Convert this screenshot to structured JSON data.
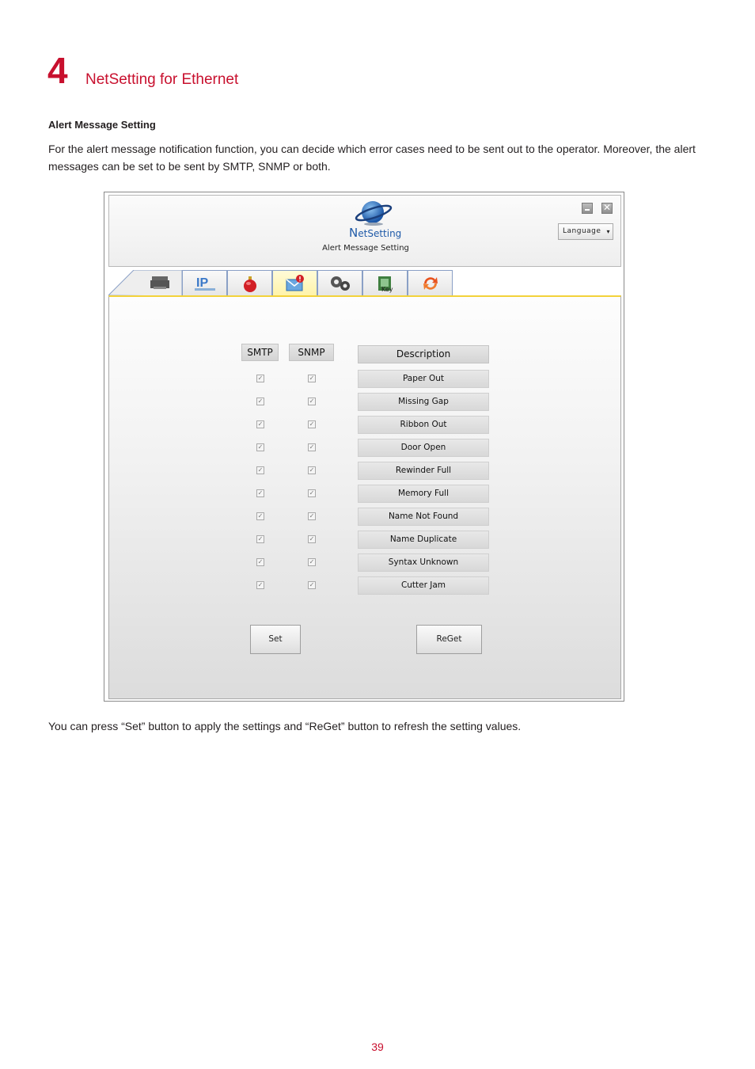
{
  "chapter": {
    "number": "4",
    "title": "NetSetting for Ethernet"
  },
  "section": {
    "heading": "Alert Message Setting",
    "intro": "For the alert message notification function, you can decide which error cases need to be sent out to the operator. Moreover, the alert messages can be set to be sent by SMTP, SNMP or both.",
    "footer_note": "You can press “Set” button to apply the settings and “ReGet” button to refresh the setting values."
  },
  "window": {
    "logo_text_initial": "N",
    "logo_text_rest": "etSetting",
    "title": "Alert Message Setting",
    "language_label": "Language",
    "close_glyph": "✕"
  },
  "tabs": [
    {
      "icon": "printer-icon"
    },
    {
      "icon": "ip-networking-icon"
    },
    {
      "icon": "alert-bell-icon"
    },
    {
      "icon": "alert-message-icon",
      "active": true
    },
    {
      "icon": "gears-icon"
    },
    {
      "icon": "key-file-icon"
    },
    {
      "icon": "refresh-icon"
    }
  ],
  "table": {
    "headers": {
      "smtp": "SMTP",
      "snmp": "SNMP",
      "description": "Description"
    },
    "rows": [
      {
        "description": "Paper Out",
        "smtp": true,
        "snmp": true
      },
      {
        "description": "Missing Gap",
        "smtp": true,
        "snmp": true
      },
      {
        "description": "Ribbon Out",
        "smtp": true,
        "snmp": true
      },
      {
        "description": "Door Open",
        "smtp": true,
        "snmp": true
      },
      {
        "description": "Rewinder Full",
        "smtp": true,
        "snmp": true
      },
      {
        "description": "Memory Full",
        "smtp": true,
        "snmp": true
      },
      {
        "description": "Name Not Found",
        "smtp": true,
        "snmp": true
      },
      {
        "description": "Name Duplicate",
        "smtp": true,
        "snmp": true
      },
      {
        "description": "Syntax Unknown",
        "smtp": true,
        "snmp": true
      },
      {
        "description": "Cutter Jam",
        "smtp": true,
        "snmp": true
      }
    ]
  },
  "buttons": {
    "set": "Set",
    "reget": "ReGet"
  },
  "page_number": "39",
  "colors": {
    "accent": "#c8102e",
    "active_tab": "#fff3a8",
    "tab_border": "#8aa0c6"
  }
}
